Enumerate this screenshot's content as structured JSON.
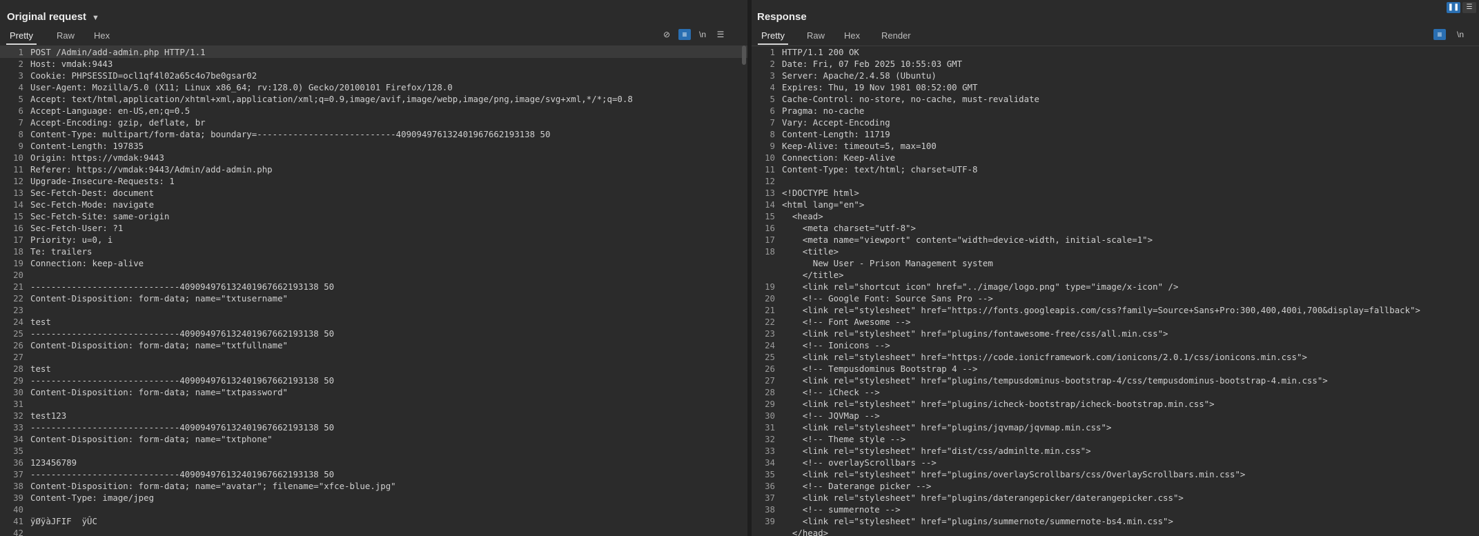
{
  "left": {
    "title": "Original request",
    "tabs": [
      "Pretty",
      "Raw",
      "Hex"
    ],
    "lines": [
      {
        "n": "1",
        "c": "POST /Admin/add-admin.php HTTP/1.1"
      },
      {
        "n": "2",
        "c": "Host: vmdak:9443"
      },
      {
        "n": "3",
        "c": "Cookie: PHPSESSID=ocl1qf4l02a65c4o7be0gsar02"
      },
      {
        "n": "4",
        "c": "User-Agent: Mozilla/5.0 (X11; Linux x86_64; rv:128.0) Gecko/20100101 Firefox/128.0"
      },
      {
        "n": "5",
        "c": "Accept: text/html,application/xhtml+xml,application/xml;q=0.9,image/avif,image/webp,image/png,image/svg+xml,*/*;q=0.8"
      },
      {
        "n": "6",
        "c": "Accept-Language: en-US,en;q=0.5"
      },
      {
        "n": "7",
        "c": "Accept-Encoding: gzip, deflate, br"
      },
      {
        "n": "8",
        "c": "Content-Type: multipart/form-data; boundary=---------------------------409094976132401967662193138 50"
      },
      {
        "n": "9",
        "c": "Content-Length: 197835"
      },
      {
        "n": "10",
        "c": "Origin: https://vmdak:9443"
      },
      {
        "n": "11",
        "c": "Referer: https://vmdak:9443/Admin/add-admin.php"
      },
      {
        "n": "12",
        "c": "Upgrade-Insecure-Requests: 1"
      },
      {
        "n": "13",
        "c": "Sec-Fetch-Dest: document"
      },
      {
        "n": "14",
        "c": "Sec-Fetch-Mode: navigate"
      },
      {
        "n": "15",
        "c": "Sec-Fetch-Site: same-origin"
      },
      {
        "n": "16",
        "c": "Sec-Fetch-User: ?1"
      },
      {
        "n": "17",
        "c": "Priority: u=0, i"
      },
      {
        "n": "18",
        "c": "Te: trailers"
      },
      {
        "n": "19",
        "c": "Connection: keep-alive"
      },
      {
        "n": "20",
        "c": ""
      },
      {
        "n": "21",
        "c": "-----------------------------409094976132401967662193138 50"
      },
      {
        "n": "22",
        "c": "Content-Disposition: form-data; name=\"txtusername\""
      },
      {
        "n": "23",
        "c": ""
      },
      {
        "n": "24",
        "c": "test"
      },
      {
        "n": "25",
        "c": "-----------------------------409094976132401967662193138 50"
      },
      {
        "n": "26",
        "c": "Content-Disposition: form-data; name=\"txtfullname\""
      },
      {
        "n": "27",
        "c": ""
      },
      {
        "n": "28",
        "c": "test"
      },
      {
        "n": "29",
        "c": "-----------------------------409094976132401967662193138 50"
      },
      {
        "n": "30",
        "c": "Content-Disposition: form-data; name=\"txtpassword\""
      },
      {
        "n": "31",
        "c": ""
      },
      {
        "n": "32",
        "c": "test123"
      },
      {
        "n": "33",
        "c": "-----------------------------409094976132401967662193138 50"
      },
      {
        "n": "34",
        "c": "Content-Disposition: form-data; name=\"txtphone\""
      },
      {
        "n": "35",
        "c": ""
      },
      {
        "n": "36",
        "c": "123456789"
      },
      {
        "n": "37",
        "c": "-----------------------------409094976132401967662193138 50"
      },
      {
        "n": "38",
        "c": "Content-Disposition: form-data; name=\"avatar\"; filename=\"xfce-blue.jpg\""
      },
      {
        "n": "39",
        "c": "Content-Type: image/jpeg"
      },
      {
        "n": "40",
        "c": ""
      },
      {
        "n": "41",
        "c": "ÿØÿàJFIF  ÿÛC"
      },
      {
        "n": "42",
        "c": ""
      }
    ]
  },
  "right": {
    "title": "Response",
    "tabs": [
      "Pretty",
      "Raw",
      "Hex",
      "Render"
    ],
    "lines": [
      {
        "n": "1",
        "c": "HTTP/1.1 200 OK"
      },
      {
        "n": "2",
        "c": "Date: Fri, 07 Feb 2025 10:55:03 GMT"
      },
      {
        "n": "3",
        "c": "Server: Apache/2.4.58 (Ubuntu)"
      },
      {
        "n": "4",
        "c": "Expires: Thu, 19 Nov 1981 08:52:00 GMT"
      },
      {
        "n": "5",
        "c": "Cache-Control: no-store, no-cache, must-revalidate"
      },
      {
        "n": "6",
        "c": "Pragma: no-cache"
      },
      {
        "n": "7",
        "c": "Vary: Accept-Encoding"
      },
      {
        "n": "8",
        "c": "Content-Length: 11719"
      },
      {
        "n": "9",
        "c": "Keep-Alive: timeout=5, max=100"
      },
      {
        "n": "10",
        "c": "Connection: Keep-Alive"
      },
      {
        "n": "11",
        "c": "Content-Type: text/html; charset=UTF-8"
      },
      {
        "n": "12",
        "c": ""
      },
      {
        "n": "13",
        "c": "<!DOCTYPE html>"
      },
      {
        "n": "14",
        "c": "<html lang=\"en\">"
      },
      {
        "n": "15",
        "c": "  <head>"
      },
      {
        "n": "16",
        "c": "    <meta charset=\"utf-8\">"
      },
      {
        "n": "17",
        "c": "    <meta name=\"viewport\" content=\"width=device-width, initial-scale=1\">"
      },
      {
        "n": "18",
        "c": "    <title>"
      },
      {
        "n": "",
        "c": "      New User - Prison Management system"
      },
      {
        "n": "",
        "c": "    </title>"
      },
      {
        "n": "19",
        "c": "    <link rel=\"shortcut icon\" href=\"../image/logo.png\" type=\"image/x-icon\" />"
      },
      {
        "n": "20",
        "c": "    <!-- Google Font: Source Sans Pro -->"
      },
      {
        "n": "21",
        "c": "    <link rel=\"stylesheet\" href=\"https://fonts.googleapis.com/css?family=Source+Sans+Pro:300,400,400i,700&display=fallback\">"
      },
      {
        "n": "22",
        "c": "    <!-- Font Awesome -->"
      },
      {
        "n": "23",
        "c": "    <link rel=\"stylesheet\" href=\"plugins/fontawesome-free/css/all.min.css\">"
      },
      {
        "n": "24",
        "c": "    <!-- Ionicons -->"
      },
      {
        "n": "25",
        "c": "    <link rel=\"stylesheet\" href=\"https://code.ionicframework.com/ionicons/2.0.1/css/ionicons.min.css\">"
      },
      {
        "n": "26",
        "c": "    <!-- Tempusdominus Bootstrap 4 -->"
      },
      {
        "n": "27",
        "c": "    <link rel=\"stylesheet\" href=\"plugins/tempusdominus-bootstrap-4/css/tempusdominus-bootstrap-4.min.css\">"
      },
      {
        "n": "28",
        "c": "    <!-- iCheck -->"
      },
      {
        "n": "29",
        "c": "    <link rel=\"stylesheet\" href=\"plugins/icheck-bootstrap/icheck-bootstrap.min.css\">"
      },
      {
        "n": "30",
        "c": "    <!-- JQVMap -->"
      },
      {
        "n": "31",
        "c": "    <link rel=\"stylesheet\" href=\"plugins/jqvmap/jqvmap.min.css\">"
      },
      {
        "n": "32",
        "c": "    <!-- Theme style -->"
      },
      {
        "n": "33",
        "c": "    <link rel=\"stylesheet\" href=\"dist/css/adminlte.min.css\">"
      },
      {
        "n": "34",
        "c": "    <!-- overlayScrollbars -->"
      },
      {
        "n": "35",
        "c": "    <link rel=\"stylesheet\" href=\"plugins/overlayScrollbars/css/OverlayScrollbars.min.css\">"
      },
      {
        "n": "36",
        "c": "    <!-- Daterange picker -->"
      },
      {
        "n": "37",
        "c": "    <link rel=\"stylesheet\" href=\"plugins/daterangepicker/daterangepicker.css\">"
      },
      {
        "n": "38",
        "c": "    <!-- summernote -->"
      },
      {
        "n": "39",
        "c": "    <link rel=\"stylesheet\" href=\"plugins/summernote/summernote-bs4.min.css\">"
      },
      {
        "n": "",
        "c": "  </head>"
      }
    ]
  }
}
